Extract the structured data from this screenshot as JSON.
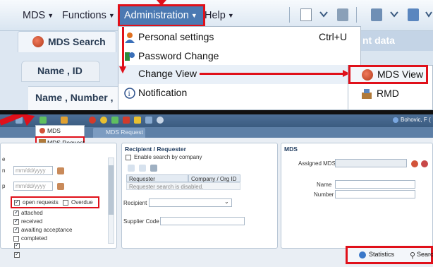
{
  "top": {
    "menu": {
      "mds": "MDS",
      "functions": "Functions",
      "administration": "Administration",
      "help": "Help"
    },
    "dropdown": {
      "personal_settings": "Personal settings",
      "personal_settings_shortcut": "Ctrl+U",
      "password_change": "Password Change",
      "change_view": "Change View",
      "notification": "Notification"
    },
    "submenu": {
      "mds_view": "MDS View",
      "rmd": "RMD"
    },
    "tabs": {
      "mds_search": "MDS Search",
      "name_id": "Name , ID",
      "name_number": "Name , Number ,",
      "print_data": "nt data"
    }
  },
  "bottom": {
    "user": "Bohovic, F (",
    "menu": {
      "mds": "MDS",
      "mds_request": "MDS Request"
    },
    "tab": "MDS Request",
    "left_pane": {
      "date_from_label": "e",
      "date_placeholder": "mm/dd/yyyy",
      "date_label_1": "n",
      "date_label_2": "p",
      "open_requests": "open requests",
      "overdue": "Overdue",
      "statuses": [
        "attached",
        "received",
        "awaiting acceptance",
        "completed"
      ]
    },
    "mid_pane": {
      "title": "Recipient / Requester",
      "enable_search": "Enable search by company",
      "col_requester": "Requester",
      "col_company": "Company / Org ID",
      "disabled_msg": "Requester search is disabled.",
      "recipient_label": "Recipient",
      "supplier_code_label": "Supplier Code"
    },
    "right_pane": {
      "title": "MDS",
      "assigned_mds": "Assigned MDS",
      "name": "Name",
      "number": "Number"
    },
    "footer": {
      "statistics": "Statistics",
      "search": "Search"
    }
  },
  "colors": {
    "highlight": "#e0101a",
    "menu_selected": "#4b79b2",
    "toolbar": "#3b5b80"
  }
}
